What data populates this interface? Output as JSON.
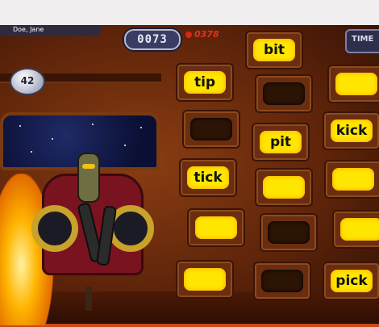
{
  "hud": {
    "player_name": "Doe, Jane",
    "score": "0073",
    "target_score": "0378",
    "time_label": "TIME"
  },
  "badge": {
    "value": "42"
  },
  "tiles": [
    {
      "word": "bit",
      "lit": true
    },
    {
      "word": "tip",
      "lit": true
    },
    {
      "word": "",
      "lit": false
    },
    {
      "word": "",
      "lit": true
    },
    {
      "word": "",
      "lit": false
    },
    {
      "word": "pit",
      "lit": true
    },
    {
      "word": "kick",
      "lit": true
    },
    {
      "word": "tick",
      "lit": true
    },
    {
      "word": "",
      "lit": true
    },
    {
      "word": "",
      "lit": true
    },
    {
      "word": "",
      "lit": true
    },
    {
      "word": "",
      "lit": false
    },
    {
      "word": "",
      "lit": true
    },
    {
      "word": "",
      "lit": true
    },
    {
      "word": "",
      "lit": false
    },
    {
      "word": "pick",
      "lit": true
    }
  ]
}
